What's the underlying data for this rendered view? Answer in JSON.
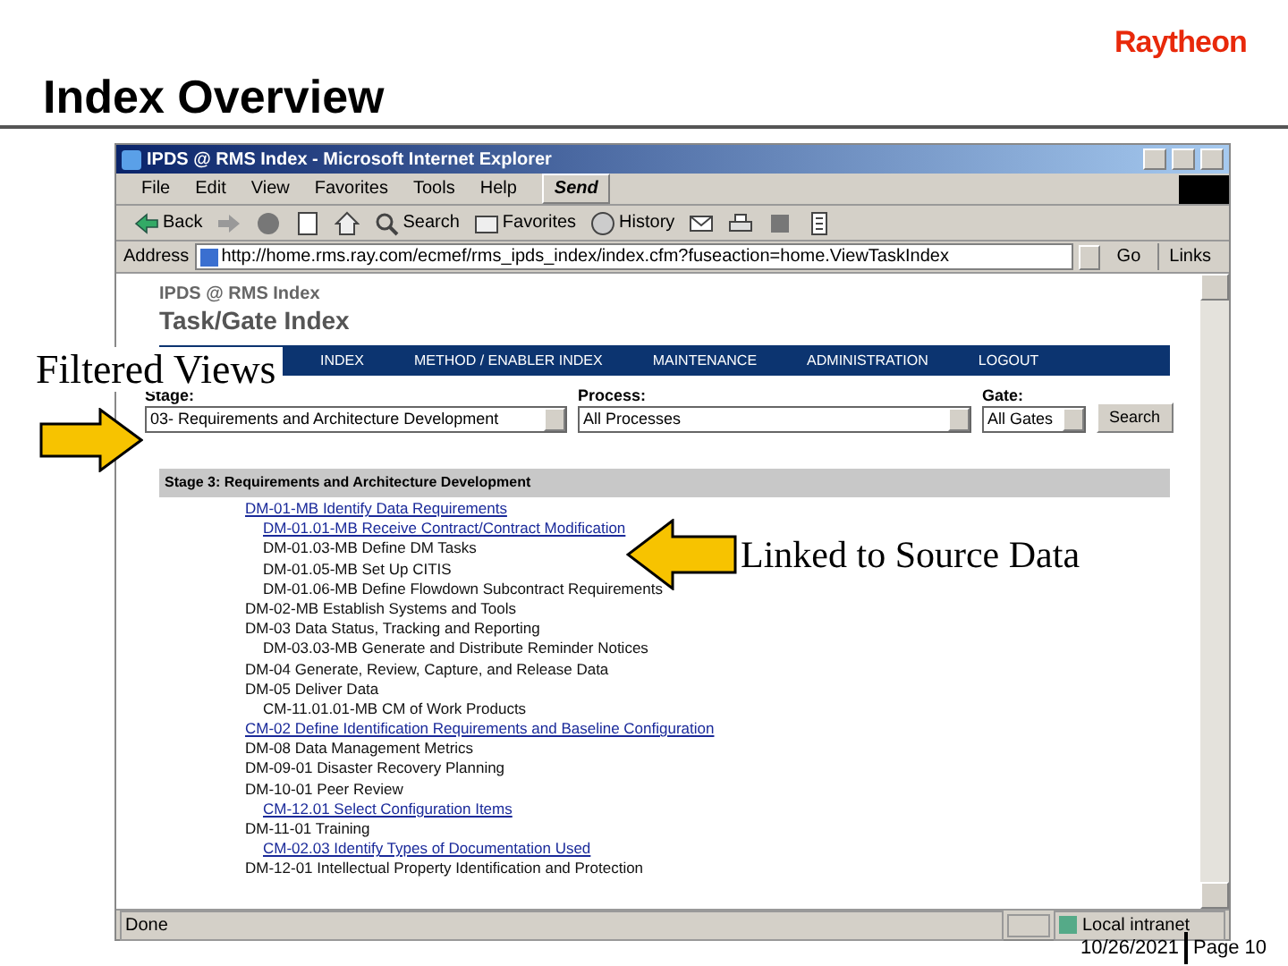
{
  "logo": "Raytheon",
  "slide_title": "Index Overview",
  "browser": {
    "title": "IPDS @ RMS Index - Microsoft Internet Explorer",
    "menu": [
      "File",
      "Edit",
      "View",
      "Favorites",
      "Tools",
      "Help"
    ],
    "send_button": "Send",
    "toolbar": [
      {
        "kind": "back",
        "label": "Back"
      },
      {
        "kind": "forward"
      },
      {
        "kind": "stop"
      },
      {
        "kind": "refresh"
      },
      {
        "kind": "home"
      },
      {
        "kind": "search",
        "label": "Search"
      },
      {
        "kind": "favorites",
        "label": "Favorites"
      },
      {
        "kind": "history",
        "label": "History"
      },
      {
        "kind": "mail"
      },
      {
        "kind": "print"
      },
      {
        "kind": "edit"
      },
      {
        "kind": "discuss"
      }
    ],
    "address_label": "Address",
    "url": "http://home.rms.ray.com/ecmef/rms_ipds_index/index.cfm?fuseaction=home.ViewTaskIndex",
    "go_button": "Go",
    "links_button": "Links",
    "status": "Done",
    "zone": "Local intranet"
  },
  "page": {
    "site": "IPDS @ RMS Index",
    "heading": "Task/Gate Index",
    "nav": [
      "INDEX",
      "METHOD / ENABLER INDEX",
      "MAINTENANCE",
      "ADMINISTRATION",
      "LOGOUT"
    ],
    "filters": [
      {
        "label": "Stage:",
        "value": "03- Requirements and Architecture Development"
      },
      {
        "label": "Process:",
        "value": "All Processes"
      },
      {
        "label": "Gate:",
        "value": "All Gates"
      }
    ],
    "search_button": "Search",
    "section": "Stage 3: Requirements and Architecture Development",
    "tasks": [
      {
        "text": "DM-01-MB Identify Data Requirements",
        "link": true,
        "children": [
          {
            "text": "DM-01.01-MB Receive Contract/Contract Modification",
            "link": true
          },
          {
            "text": "DM-01.03-MB Define DM Tasks",
            "link": false
          },
          {
            "text": "DM-01.05-MB Set Up CITIS",
            "link": false
          },
          {
            "text": "DM-01.06-MB Define Flowdown Subcontract Requirements",
            "link": false
          }
        ]
      },
      {
        "text": "DM-02-MB Establish Systems and Tools",
        "link": false
      },
      {
        "text": "DM-03 Data Status, Tracking and Reporting",
        "link": false,
        "children": [
          {
            "text": "DM-03.03-MB Generate and Distribute Reminder Notices",
            "link": false
          }
        ]
      },
      {
        "text": "DM-04 Generate, Review, Capture, and Release Data",
        "link": false
      },
      {
        "text": "DM-05 Deliver Data",
        "link": false,
        "children": [
          {
            "text": "CM-11.01.01-MB CM of Work Products",
            "link": false
          }
        ]
      },
      {
        "text": "CM-02 Define Identification Requirements and Baseline Configuration",
        "link": true
      },
      {
        "text": "DM-08 Data Management Metrics",
        "link": false
      },
      {
        "text": "DM-09-01 Disaster Recovery Planning",
        "link": false
      },
      {
        "text": "DM-10-01 Peer Review",
        "link": false,
        "children": [
          {
            "text": "CM-12.01 Select Configuration Items",
            "link": true
          }
        ]
      },
      {
        "text": "DM-11-01 Training",
        "link": false,
        "children": [
          {
            "text": "CM-02.03 Identify Types of Documentation Used",
            "link": true
          }
        ]
      },
      {
        "text": "DM-12-01 Intellectual Property Identification and Protection",
        "link": false
      }
    ]
  },
  "callouts": [
    "Filtered Views",
    "Linked to Source Data"
  ],
  "footer": {
    "date": "10/26/2021",
    "page": "Page 10"
  }
}
